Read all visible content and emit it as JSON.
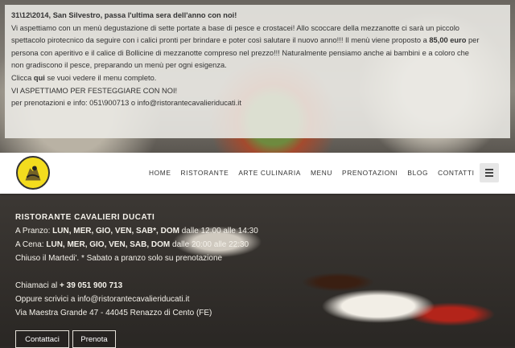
{
  "notice": {
    "title": "31\\12\\2014, San Silvestro, passa l'ultima sera dell'anno con noi!",
    "line1": "Vi aspettiamo con un menù degustazione di sette portate a base di pesce e crostacei! Allo scoccare della mezzanotte ci sarà un piccolo",
    "line2_a": "spettacolo pirotecnico da seguire con i calici pronti per brindare e poter così salutare il nuovo anno!!! Il menù viene proposto a ",
    "line2_price": "85,00 euro",
    "line2_b": " per",
    "line3": "persona con aperitivo e il calice di Bollicine di mezzanotte compreso nel prezzo!!!  Naturalmente pensiamo anche ai bambini e a coloro che",
    "line4": "non gradiscono il pesce, preparando un menù per ogni esigenza.",
    "line5_a": "Clicca ",
    "line5_link": "qui",
    "line5_b": " se vuoi vedere il menu completo.",
    "line6": "VI ASPETTIAMO PER FESTEGGIARE CON NOI!",
    "line7": "per prenotazioni e info: 051\\900713 o info@ristorantecavalieriducati.it"
  },
  "nav": {
    "items": [
      "HOME",
      "RISTORANTE",
      "ARTE CULINARIA",
      "MENU",
      "PRENOTAZIONI",
      "BLOG",
      "CONTATTI"
    ]
  },
  "info": {
    "name": "RISTORANTE CAVALIERI DUCATI",
    "lunch_prefix": "A Pranzo: ",
    "lunch_days": "LUN, MER, GIO, VEN, SAB*, DOM",
    "lunch_hours": " dalle 12:00 alle 14:30",
    "dinner_prefix": "A Cena: ",
    "dinner_days": "LUN, MER, GIO, VEN, SAB, DOM",
    "dinner_hours": " dalle 20:00 alle 22:30",
    "closed": "Chiuso il Martedi'.  * Sabato a pranzo solo su prenotazione",
    "call_prefix": "Chiamaci al ",
    "phone": "+ 39 051 900 713",
    "email_line": "Oppure scrivici a info@ristorantecavalieriducati.it",
    "address": "Via Maestra Grande 47 - 44045 Renazzo di Cento (FE)"
  },
  "buttons": {
    "contact": "Contattaci",
    "book": "Prenota"
  },
  "icons": {
    "menu": "hamburger-menu-icon",
    "logo": "knight-logo-icon"
  }
}
